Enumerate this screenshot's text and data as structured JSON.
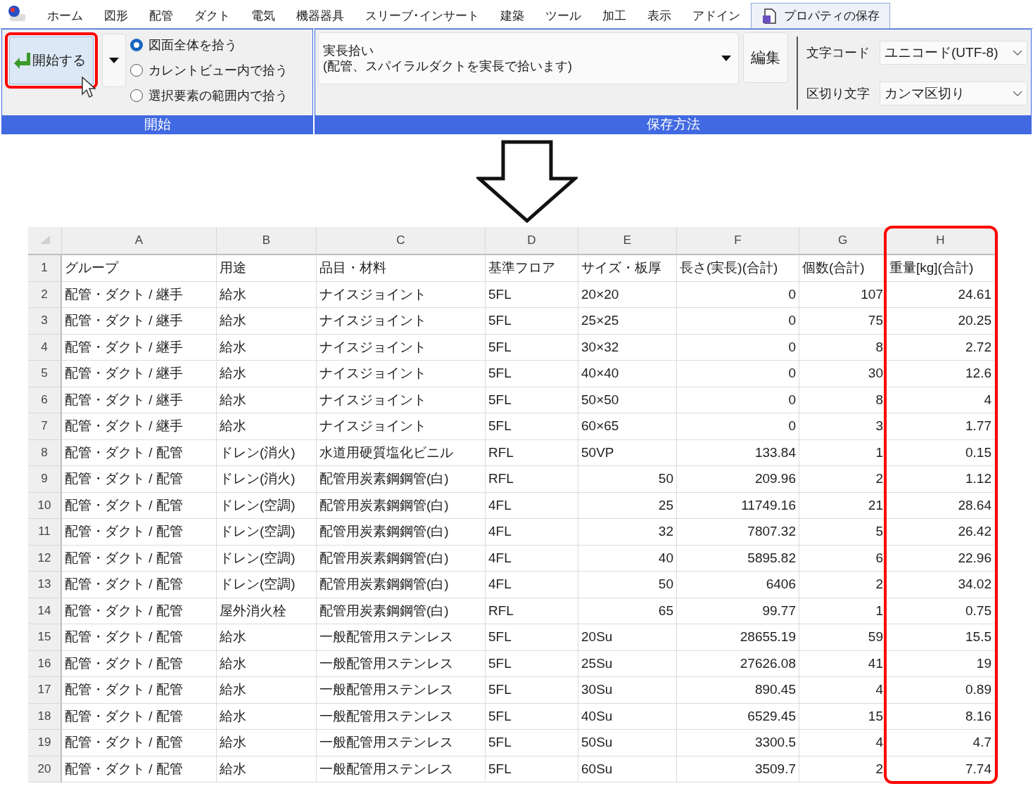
{
  "ribbon": {
    "tabs": [
      {
        "label": "ホーム",
        "selected": false
      },
      {
        "label": "図形",
        "selected": false
      },
      {
        "label": "配管",
        "selected": false
      },
      {
        "label": "ダクト",
        "selected": false
      },
      {
        "label": "電気",
        "selected": false
      },
      {
        "label": "機器器具",
        "selected": false
      },
      {
        "label": "スリーブ･インサート",
        "selected": false
      },
      {
        "label": "建築",
        "selected": false
      },
      {
        "label": "ツール",
        "selected": false
      },
      {
        "label": "加工",
        "selected": false
      },
      {
        "label": "表示",
        "selected": false
      },
      {
        "label": "アドイン",
        "selected": false
      },
      {
        "label": "プロパティの保存",
        "selected": true
      }
    ],
    "start_group": {
      "label": "開始",
      "start_button": {
        "label": "開始する",
        "highlighted": true
      },
      "scope_options": [
        {
          "label": "図面全体を拾う",
          "selected": true
        },
        {
          "label": "カレントビュー内で拾う",
          "selected": false
        },
        {
          "label": "選択要素の範囲内で拾う",
          "selected": false
        }
      ]
    },
    "save_group": {
      "label": "保存方法",
      "method": {
        "lines": [
          "実長拾い",
          "(配管、スパイラルダクトを実長で拾います)"
        ]
      },
      "edit_button": "編集",
      "settings": [
        {
          "label": "文字コード",
          "value": "ユニコード(UTF-8)"
        },
        {
          "label": "区切り文字",
          "value": "カンマ区切り"
        }
      ]
    }
  },
  "sheet": {
    "columns": [
      {
        "label": "A",
        "highlighted": false
      },
      {
        "label": "B",
        "highlighted": false
      },
      {
        "label": "C",
        "highlighted": false
      },
      {
        "label": "D",
        "highlighted": false
      },
      {
        "label": "E",
        "highlighted": false
      },
      {
        "label": "F",
        "highlighted": false
      },
      {
        "label": "G",
        "highlighted": false
      },
      {
        "label": "H",
        "highlighted": true
      }
    ],
    "rows": [
      {
        "number": "1",
        "kind": "header",
        "cells": [
          "グループ",
          "用途",
          "品目・材料",
          "基準フロア",
          "サイズ・板厚",
          "長さ(実長)(合計)",
          "個数(合計)",
          "重量[kg](合計)"
        ]
      },
      {
        "number": "2",
        "kind": "data",
        "size_numeric": false,
        "cells": [
          "配管・ダクト / 継手",
          "給水",
          "ナイスジョイント",
          "5FL",
          "20×20",
          "0",
          "107",
          "24.61"
        ]
      },
      {
        "number": "3",
        "kind": "data",
        "size_numeric": false,
        "cells": [
          "配管・ダクト / 継手",
          "給水",
          "ナイスジョイント",
          "5FL",
          "25×25",
          "0",
          "75",
          "20.25"
        ]
      },
      {
        "number": "4",
        "kind": "data",
        "size_numeric": false,
        "cells": [
          "配管・ダクト / 継手",
          "給水",
          "ナイスジョイント",
          "5FL",
          "30×32",
          "0",
          "8",
          "2.72"
        ]
      },
      {
        "number": "5",
        "kind": "data",
        "size_numeric": false,
        "cells": [
          "配管・ダクト / 継手",
          "給水",
          "ナイスジョイント",
          "5FL",
          "40×40",
          "0",
          "30",
          "12.6"
        ]
      },
      {
        "number": "6",
        "kind": "data",
        "size_numeric": false,
        "cells": [
          "配管・ダクト / 継手",
          "給水",
          "ナイスジョイント",
          "5FL",
          "50×50",
          "0",
          "8",
          "4"
        ]
      },
      {
        "number": "7",
        "kind": "data",
        "size_numeric": false,
        "cells": [
          "配管・ダクト / 継手",
          "給水",
          "ナイスジョイント",
          "5FL",
          "60×65",
          "0",
          "3",
          "1.77"
        ]
      },
      {
        "number": "8",
        "kind": "data",
        "size_numeric": false,
        "cells": [
          "配管・ダクト / 配管",
          "ドレン(消火)",
          "水道用硬質塩化ビニル",
          "RFL",
          "50VP",
          "133.84",
          "1",
          "0.15"
        ]
      },
      {
        "number": "9",
        "kind": "data",
        "size_numeric": true,
        "cells": [
          "配管・ダクト / 配管",
          "ドレン(消火)",
          "配管用炭素鋼鋼管(白)",
          "RFL",
          "50",
          "209.96",
          "2",
          "1.12"
        ]
      },
      {
        "number": "10",
        "kind": "data",
        "size_numeric": true,
        "cells": [
          "配管・ダクト / 配管",
          "ドレン(空調)",
          "配管用炭素鋼鋼管(白)",
          "4FL",
          "25",
          "11749.16",
          "21",
          "28.64"
        ]
      },
      {
        "number": "11",
        "kind": "data",
        "size_numeric": true,
        "cells": [
          "配管・ダクト / 配管",
          "ドレン(空調)",
          "配管用炭素鋼鋼管(白)",
          "4FL",
          "32",
          "7807.32",
          "5",
          "26.42"
        ]
      },
      {
        "number": "12",
        "kind": "data",
        "size_numeric": true,
        "cells": [
          "配管・ダクト / 配管",
          "ドレン(空調)",
          "配管用炭素鋼鋼管(白)",
          "4FL",
          "40",
          "5895.82",
          "6",
          "22.96"
        ]
      },
      {
        "number": "13",
        "kind": "data",
        "size_numeric": true,
        "cells": [
          "配管・ダクト / 配管",
          "ドレン(空調)",
          "配管用炭素鋼鋼管(白)",
          "4FL",
          "50",
          "6406",
          "2",
          "34.02"
        ]
      },
      {
        "number": "14",
        "kind": "data",
        "size_numeric": true,
        "cells": [
          "配管・ダクト / 配管",
          "屋外消火栓",
          "配管用炭素鋼鋼管(白)",
          "RFL",
          "65",
          "99.77",
          "1",
          "0.75"
        ]
      },
      {
        "number": "15",
        "kind": "data",
        "size_numeric": false,
        "cells": [
          "配管・ダクト / 配管",
          "給水",
          "一般配管用ステンレス",
          "5FL",
          "20Su",
          "28655.19",
          "59",
          "15.5"
        ]
      },
      {
        "number": "16",
        "kind": "data",
        "size_numeric": false,
        "cells": [
          "配管・ダクト / 配管",
          "給水",
          "一般配管用ステンレス",
          "5FL",
          "25Su",
          "27626.08",
          "41",
          "19"
        ]
      },
      {
        "number": "17",
        "kind": "data",
        "size_numeric": false,
        "cells": [
          "配管・ダクト / 配管",
          "給水",
          "一般配管用ステンレス",
          "5FL",
          "30Su",
          "890.45",
          "4",
          "0.89"
        ]
      },
      {
        "number": "18",
        "kind": "data",
        "size_numeric": false,
        "cells": [
          "配管・ダクト / 配管",
          "給水",
          "一般配管用ステンレス",
          "5FL",
          "40Su",
          "6529.45",
          "15",
          "8.16"
        ]
      },
      {
        "number": "19",
        "kind": "data",
        "size_numeric": false,
        "cells": [
          "配管・ダクト / 配管",
          "給水",
          "一般配管用ステンレス",
          "5FL",
          "50Su",
          "3300.5",
          "4",
          "4.7"
        ]
      },
      {
        "number": "20",
        "kind": "data",
        "size_numeric": false,
        "cells": [
          "配管・ダクト / 配管",
          "給水",
          "一般配管用ステンレス",
          "5FL",
          "60Su",
          "3509.7",
          "2",
          "7.74"
        ]
      }
    ]
  }
}
